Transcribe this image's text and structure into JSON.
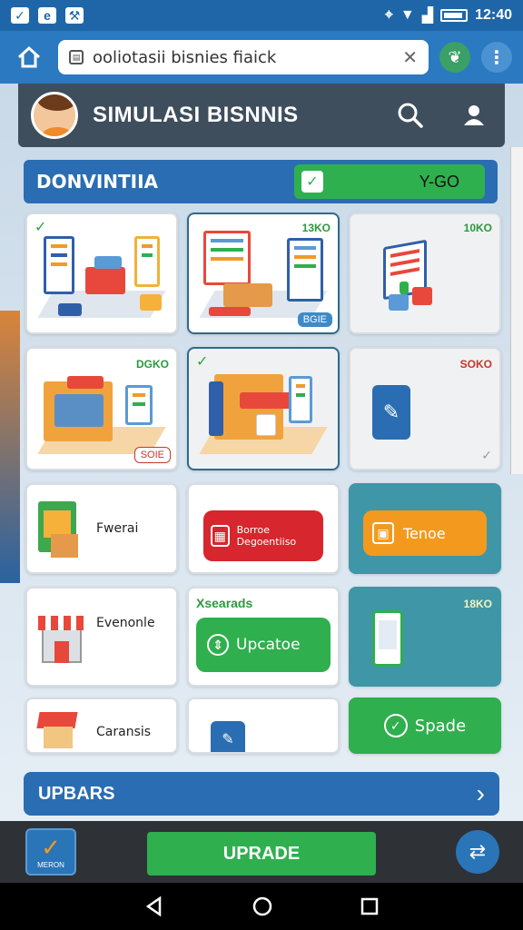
{
  "status_bar": {
    "time": "12:40"
  },
  "browser": {
    "url": "ooliotasii bisnies fiaick"
  },
  "app": {
    "title": "SIMULASI BISNNIS"
  },
  "dashboard": {
    "label": "DONVINTIIA",
    "value": "Y-GO"
  },
  "cards": [
    {
      "tag": ""
    },
    {
      "tag": "13KO",
      "pill": "BGIE"
    },
    {
      "tag": "10KO"
    },
    {
      "tag": "DGKO",
      "pill": "SOIE"
    },
    {
      "tag": ""
    },
    {
      "tag": "SOKO"
    },
    {
      "label": "Fwerai"
    },
    {
      "button_text": "Borroe Degoentiiso"
    },
    {
      "button_text": "Tenoe"
    },
    {
      "label": "Evenonle"
    },
    {
      "header": "Xsearads",
      "button_text": "Upcatoe"
    },
    {
      "tag": "18KO"
    },
    {
      "label": "Caransis"
    },
    {
      "label": ""
    },
    {
      "button_text": "Spade"
    }
  ],
  "updates_bar": {
    "label": "UPBARS"
  },
  "action_bar": {
    "left_label": "MERON",
    "upgrade_label": "UPRADE"
  },
  "colors": {
    "primary": "#2a6db2",
    "green": "#2faf4e",
    "red": "#d7262d",
    "orange": "#f39a1e",
    "teal": "#3f96a6",
    "header": "#3e4e5d"
  }
}
